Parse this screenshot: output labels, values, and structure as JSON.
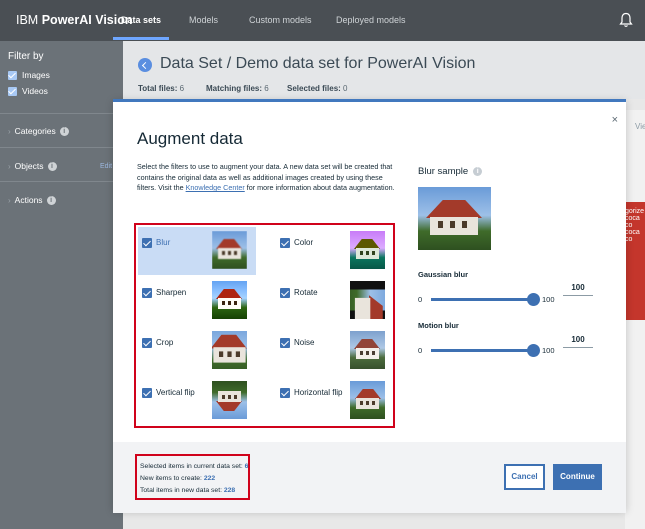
{
  "topnav": {
    "brand_prefix": "IBM",
    "brand_name": "PowerAI Vision",
    "tabs": [
      "Data sets",
      "Models",
      "Custom models",
      "Deployed models"
    ],
    "active_tab": "Data sets",
    "notification_icon": "bell-icon"
  },
  "sidebar": {
    "filter_by": "Filter by",
    "filters": [
      {
        "label": "Images",
        "checked": true
      },
      {
        "label": "Videos",
        "checked": true
      }
    ],
    "sections": [
      "Categories",
      "Objects",
      "Actions"
    ],
    "edit_label": "Edit"
  },
  "page": {
    "title": "Data Set / Demo data set for PowerAI Vision",
    "stats": {
      "total_label": "Total files:",
      "total_value": "6",
      "matching_label": "Matching files:",
      "matching_value": "6",
      "selected_label": "Selected files:",
      "selected_value": "0"
    },
    "bg_right_text": "Vie",
    "bg_card_text": "gorize coca co coca co"
  },
  "modal": {
    "close": "×",
    "title": "Augment data",
    "description_before": "Select the filters to use to augment your data. A new data set will be created that contains the original data as well as additional images created by using these filters. Visit the ",
    "description_link": "Knowledge Center",
    "description_after": " for more information about data augmentation.",
    "filters": [
      {
        "label": "Blur",
        "checked": true,
        "selected": true
      },
      {
        "label": "Color",
        "checked": true,
        "selected": false
      },
      {
        "label": "Sharpen",
        "checked": true,
        "selected": false
      },
      {
        "label": "Rotate",
        "checked": true,
        "selected": false
      },
      {
        "label": "Crop",
        "checked": true,
        "selected": false
      },
      {
        "label": "Noise",
        "checked": true,
        "selected": false
      },
      {
        "label": "Vertical flip",
        "checked": true,
        "selected": false
      },
      {
        "label": "Horizontal flip",
        "checked": true,
        "selected": false
      }
    ],
    "sample_title": "Blur sample",
    "sliders": [
      {
        "label": "Gaussian blur",
        "min": "0",
        "max": "100",
        "value": "100"
      },
      {
        "label": "Motion blur",
        "min": "0",
        "max": "100",
        "value": "100"
      }
    ],
    "summary": {
      "selected_label": "Selected items in current data set:",
      "selected_value": "6",
      "new_label": "New items to create:",
      "new_value": "222",
      "total_label": "Total items in new data set:",
      "total_value": "228"
    },
    "cancel": "Cancel",
    "continue": "Continue"
  },
  "colors": {
    "accent": "#3d70b2",
    "highlight_border": "#d0021b",
    "nav_bg": "#4a4f54",
    "sidebar_bg": "#6b7278"
  }
}
